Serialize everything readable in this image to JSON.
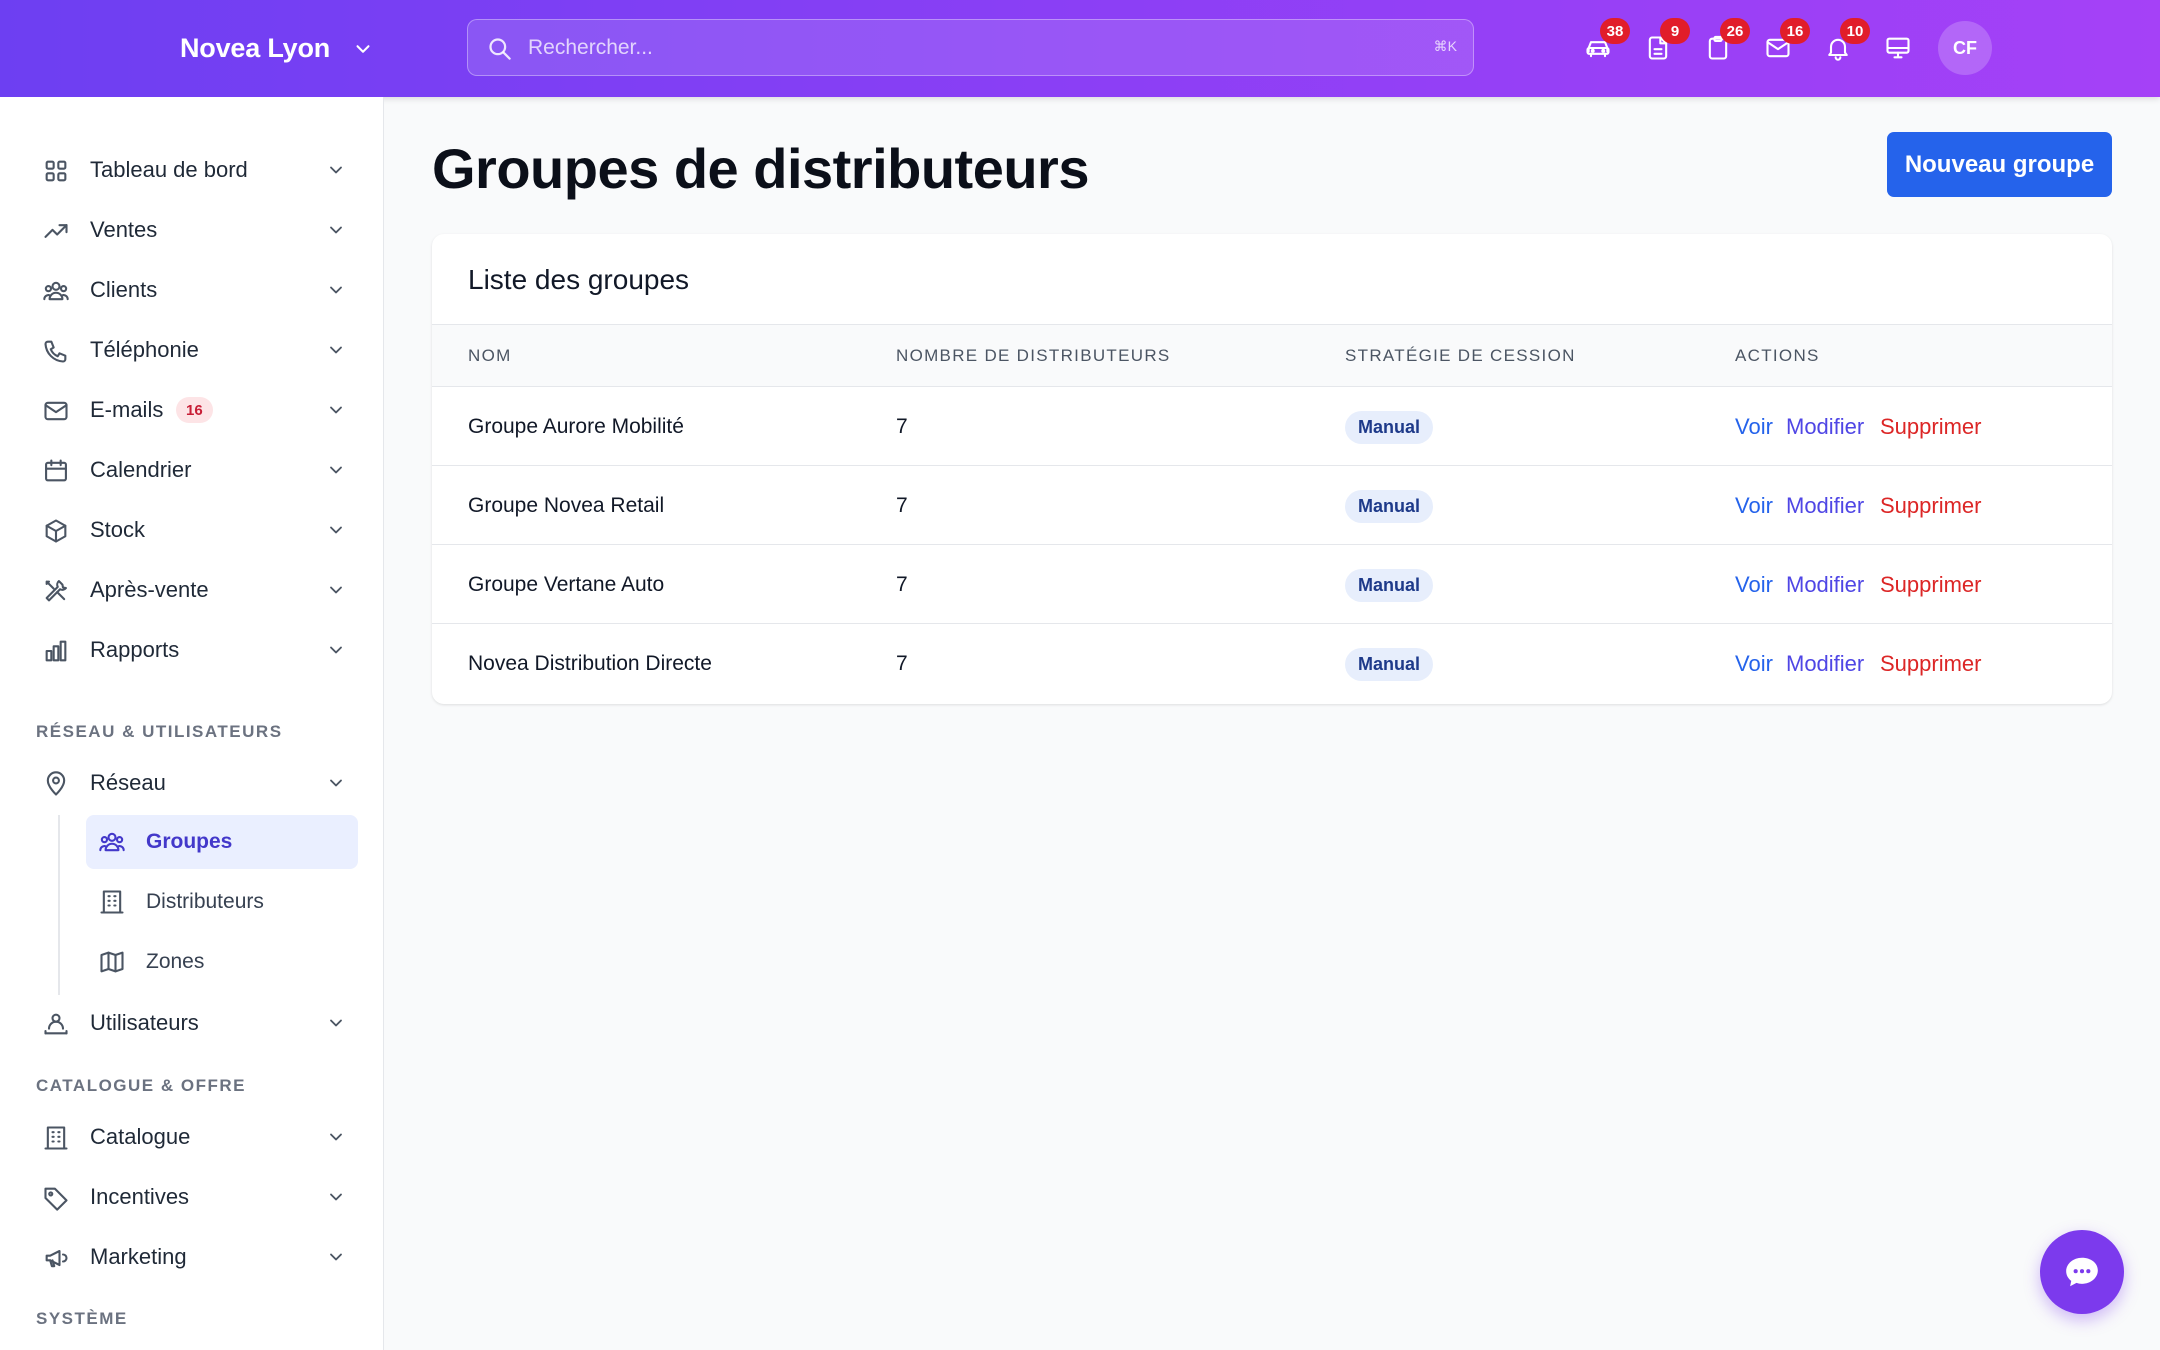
{
  "header": {
    "brand": "Novea Lyon",
    "search_placeholder": "Rechercher...",
    "search_shortcut": "⌘K",
    "icons": [
      {
        "name": "car-icon",
        "badge": "38"
      },
      {
        "name": "document-icon",
        "badge": "9"
      },
      {
        "name": "clipboard-icon",
        "badge": "26"
      },
      {
        "name": "mail-icon",
        "badge": "16"
      },
      {
        "name": "bell-icon",
        "badge": "10"
      },
      {
        "name": "monitor-icon",
        "badge": ""
      }
    ],
    "avatar_initials": "CF"
  },
  "sidebar": {
    "items": [
      {
        "label": "Tableau de bord",
        "icon": "grid-icon"
      },
      {
        "label": "Ventes",
        "icon": "trending-up-icon"
      },
      {
        "label": "Clients",
        "icon": "users-icon"
      },
      {
        "label": "Téléphonie",
        "icon": "phone-icon"
      },
      {
        "label": "E-mails",
        "icon": "mail-icon",
        "badge": "16"
      },
      {
        "label": "Calendrier",
        "icon": "calendar-icon"
      },
      {
        "label": "Stock",
        "icon": "cube-icon"
      },
      {
        "label": "Après-vente",
        "icon": "wrench-icon"
      },
      {
        "label": "Rapports",
        "icon": "bar-chart-icon"
      }
    ],
    "section_network": "RÉSEAU & UTILISATEURS",
    "network": {
      "label": "Réseau",
      "icon": "map-pin-icon"
    },
    "network_sub": [
      {
        "label": "Groupes",
        "icon": "users-icon",
        "active": true
      },
      {
        "label": "Distributeurs",
        "icon": "building-icon"
      },
      {
        "label": "Zones",
        "icon": "map-icon"
      }
    ],
    "users": {
      "label": "Utilisateurs",
      "icon": "user-group-icon"
    },
    "section_catalog": "CATALOGUE & OFFRE",
    "catalog_items": [
      {
        "label": "Catalogue",
        "icon": "building-icon"
      },
      {
        "label": "Incentives",
        "icon": "tag-icon"
      },
      {
        "label": "Marketing",
        "icon": "megaphone-icon"
      }
    ],
    "section_system": "SYSTÈME"
  },
  "main": {
    "title": "Groupes de distributeurs",
    "new_button": "Nouveau groupe",
    "card_title": "Liste des groupes",
    "columns": [
      "NOM",
      "NOMBRE DE DISTRIBUTEURS",
      "STRATÉGIE DE CESSION",
      "ACTIONS"
    ],
    "rows": [
      {
        "name": "Groupe Aurore Mobilité",
        "count": "7",
        "strategy": "Manual"
      },
      {
        "name": "Groupe Novea Retail",
        "count": "7",
        "strategy": "Manual"
      },
      {
        "name": "Groupe Vertane Auto",
        "count": "7",
        "strategy": "Manual"
      },
      {
        "name": "Novea Distribution Directe",
        "count": "7",
        "strategy": "Manual"
      }
    ],
    "actions": {
      "view": "Voir",
      "edit": "Modifier",
      "delete": "Supprimer"
    }
  },
  "colors": {
    "accent": "#2563eb",
    "header_start": "#6d3ff2",
    "header_end": "#a541f7",
    "danger": "#dc2626"
  }
}
